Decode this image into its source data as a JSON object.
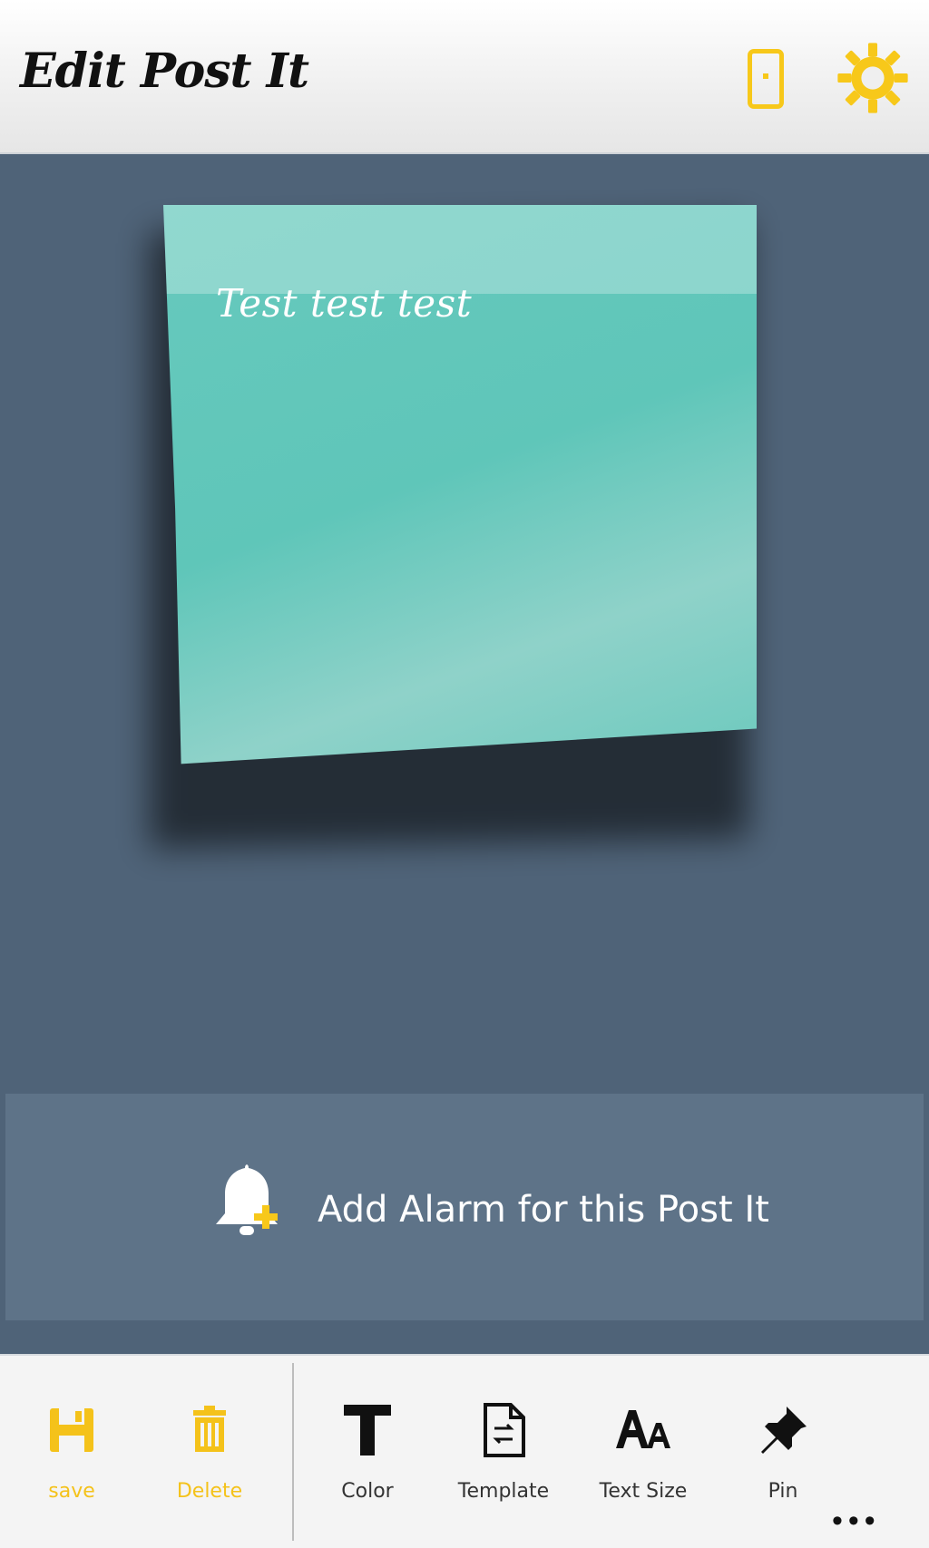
{
  "header": {
    "title": "Edit Post It"
  },
  "note": {
    "text": "Test test test"
  },
  "alarm": {
    "label": "Add Alarm for this Post It"
  },
  "toolbar": {
    "save_label": "save",
    "delete_label": "Delete",
    "color_label": "Color",
    "template_label": "Template",
    "text_size_label": "Text Size",
    "pin_label": "Pin",
    "more_label": "•••"
  },
  "colors": {
    "accent": "#f7c81a",
    "background": "#4f6378",
    "note": "#62c7bb"
  },
  "icons": {
    "phone": "phone-icon",
    "gear": "gear-icon",
    "bell": "bell-plus-icon",
    "save": "floppy-disk-icon",
    "delete": "trash-can-icon",
    "color": "text-t-icon",
    "template": "document-swap-icon",
    "text_size": "font-size-icon",
    "pin": "pushpin-icon"
  }
}
